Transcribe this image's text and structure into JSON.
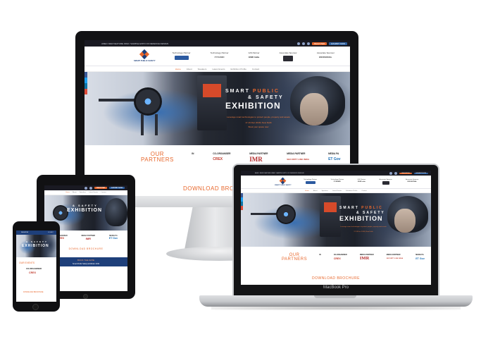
{
  "site": {
    "topbar_text": "AMEC NEW FEATURE WAR / SAMPLE EXPO OF DEFENCE DESIGN",
    "buttons": {
      "register": "REGISTER",
      "exhibit": "EXHIBIT NOW"
    },
    "logo_text": "SMART PUBLIC SAFETY",
    "header_partners": [
      {
        "label": "Technology Partner",
        "logo": ""
      },
      {
        "label": "Technology Partner",
        "logo": "PYRAMID"
      },
      {
        "label": "GIS Partner",
        "logo": "ESRI India"
      },
      {
        "label": "Associate Sponsor",
        "logo": ""
      },
      {
        "label": "Associate Sponsor",
        "logo": "ENVISIONAL"
      }
    ],
    "nav": [
      "Home",
      "About",
      "Speakers",
      "Latest Events",
      "Exhibition Profile",
      "Contact"
    ],
    "hero": {
      "smart": "SMART",
      "public": "PUBLIC",
      "safety": "& SAFETY",
      "exhibition": "EXHIBITION",
      "sub1": "Leverage smart technologies to protect people, property and assets",
      "sub2": "17-19 Dec 2018 | New Delhi",
      "sub3": "Book your space now"
    },
    "our": "OUR",
    "partners_word": "PARTNERS",
    "band_partners": [
      {
        "label": "IN",
        "name": ""
      },
      {
        "label": "CO-ORGANISER",
        "name": "CREX"
      },
      {
        "label": "MEDIA PARTNER",
        "name": "IMR"
      },
      {
        "label": "MEDIA PARTNER",
        "name": "SECURITY LINK INDIA"
      },
      {
        "label": "MEDIA PA",
        "name": "ET Gov"
      }
    ],
    "download": "DOWNLOAD BROCHURE"
  },
  "tablet": {
    "cta": "BOOK THE DATE",
    "tagline": "Smart Public Safety Exhibition 2019"
  },
  "phone": {
    "btn_left": "REGISTER",
    "btn_right": "EXHIBIT",
    "our_events": "OUR EVENTS",
    "co_organiser": "CO-ORGANISER",
    "crex": "CREX",
    "download": "DOWNLOAD BROCHURE"
  },
  "laptop": {
    "label": "MacBook Pro"
  },
  "colors": {
    "accent": "#e8672c",
    "navy": "#1e3f7a",
    "device": "#121214"
  }
}
